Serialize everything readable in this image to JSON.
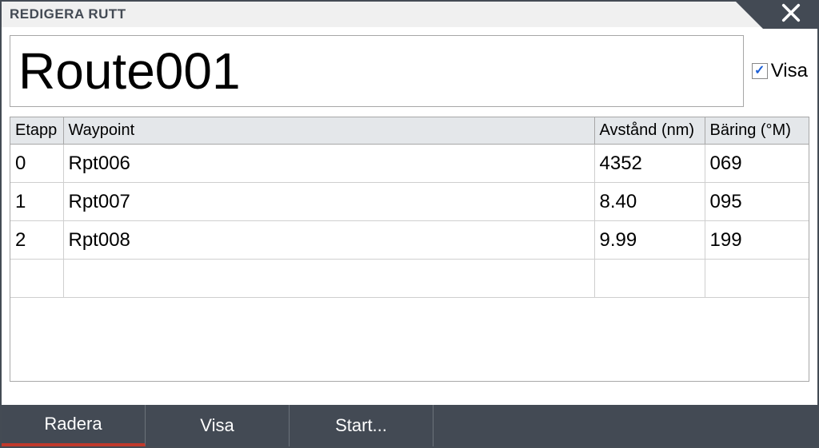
{
  "title": "REDIGERA RUTT",
  "route_name": "Route001",
  "show": {
    "label": "Visa",
    "checked": true,
    "checkmark": "✓"
  },
  "columns": {
    "etapp": "Etapp",
    "waypoint": "Waypoint",
    "dist": "Avstånd (nm)",
    "brg": "Bäring (°M)"
  },
  "rows": [
    {
      "etapp": "0",
      "waypoint": "Rpt006",
      "dist": "4352",
      "brg": "069"
    },
    {
      "etapp": "1",
      "waypoint": "Rpt007",
      "dist": "8.40",
      "brg": "095"
    },
    {
      "etapp": "2",
      "waypoint": "Rpt008",
      "dist": "9.99",
      "brg": "199"
    },
    {
      "etapp": "",
      "waypoint": "",
      "dist": "",
      "brg": ""
    }
  ],
  "buttons": {
    "delete": "Radera",
    "show": "Visa",
    "start": "Start..."
  }
}
